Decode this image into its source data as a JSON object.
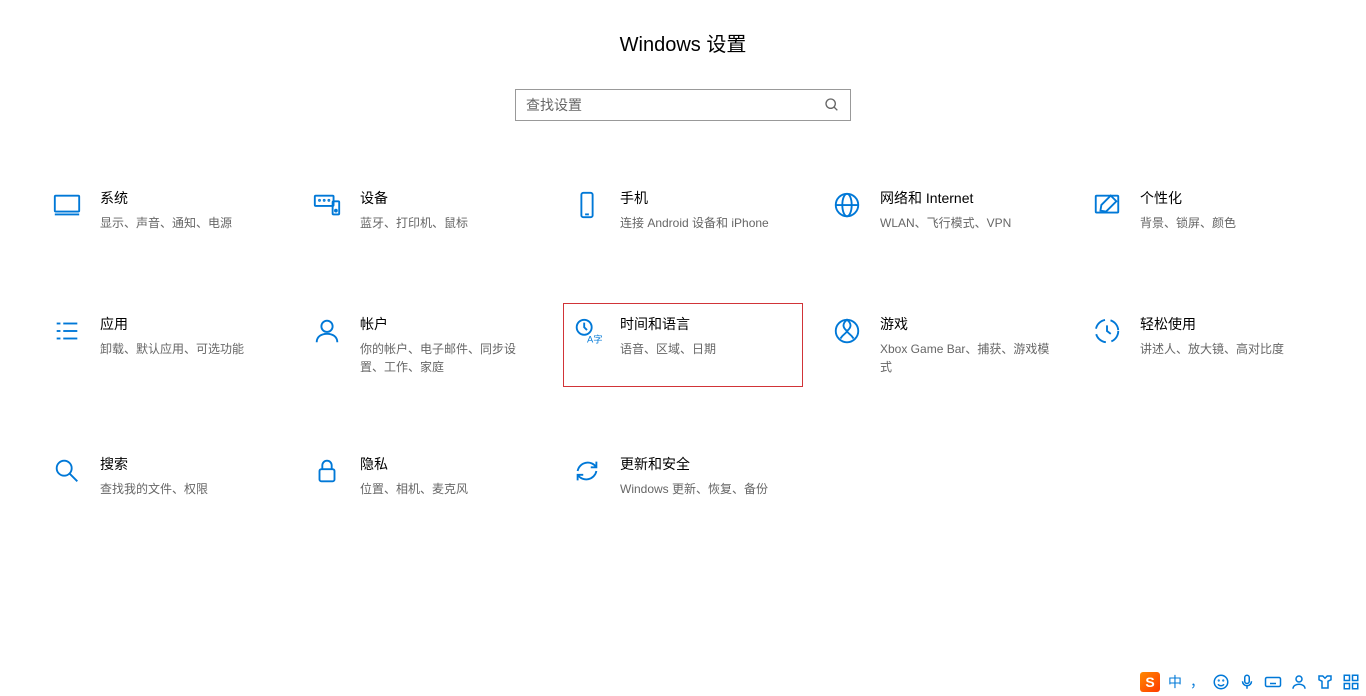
{
  "title": "Windows 设置",
  "search": {
    "placeholder": "查找设置"
  },
  "tiles": [
    {
      "id": "system",
      "title": "系统",
      "desc": "显示、声音、通知、电源"
    },
    {
      "id": "devices",
      "title": "设备",
      "desc": "蓝牙、打印机、鼠标"
    },
    {
      "id": "phone",
      "title": "手机",
      "desc": "连接 Android 设备和 iPhone"
    },
    {
      "id": "network",
      "title": "网络和 Internet",
      "desc": "WLAN、飞行模式、VPN"
    },
    {
      "id": "personalization",
      "title": "个性化",
      "desc": "背景、锁屏、颜色"
    },
    {
      "id": "apps",
      "title": "应用",
      "desc": "卸载、默认应用、可选功能"
    },
    {
      "id": "accounts",
      "title": "帐户",
      "desc": "你的帐户、电子邮件、同步设置、工作、家庭"
    },
    {
      "id": "time-language",
      "title": "时间和语言",
      "desc": "语音、区域、日期",
      "highlight": true
    },
    {
      "id": "gaming",
      "title": "游戏",
      "desc": "Xbox Game Bar、捕获、游戏模式"
    },
    {
      "id": "ease-of-access",
      "title": "轻松使用",
      "desc": "讲述人、放大镜、高对比度"
    },
    {
      "id": "search-cat",
      "title": "搜索",
      "desc": "查找我的文件、权限"
    },
    {
      "id": "privacy",
      "title": "隐私",
      "desc": "位置、相机、麦克风"
    },
    {
      "id": "update",
      "title": "更新和安全",
      "desc": "Windows 更新、恢复、备份"
    }
  ],
  "ime": {
    "logo": "S",
    "mode": "中"
  }
}
